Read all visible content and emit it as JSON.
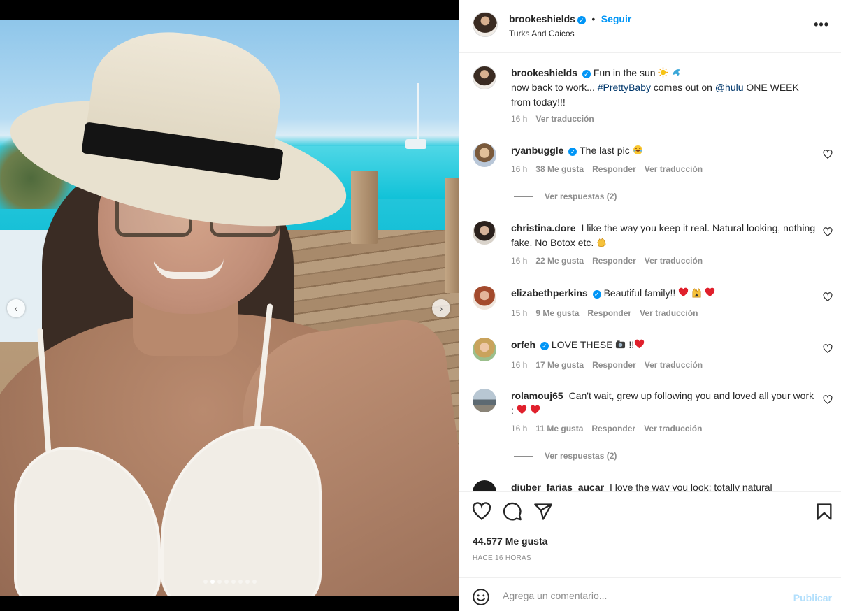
{
  "post": {
    "username": "brookeshields",
    "follow_label": "Seguir",
    "separator": "•",
    "location": "Turks And Caicos",
    "more_label": "•••",
    "carousel": {
      "slides": 8,
      "active": 1,
      "prev_label": "‹",
      "next_label": "›"
    }
  },
  "caption": {
    "username": "brookeshields",
    "text_line1": "Fun in the sun",
    "text_pre": "now back to work...",
    "hashtag": "#PrettyBaby",
    "text_mid": "comes out on",
    "mention": "@hulu",
    "text_post": "ONE WEEK from today!!!",
    "time": "16 h",
    "translate": "Ver traducción"
  },
  "comments": [
    {
      "username": "ryanbuggle",
      "verified": true,
      "text": "The last pic",
      "time": "16 h",
      "likes": "38 Me gusta",
      "reply": "Responder",
      "translate": "Ver traducción",
      "replies_label": "Ver respuestas (2)"
    },
    {
      "username": "christina.dore",
      "verified": false,
      "text": "I like the way you keep it real. Natural looking, nothing fake. No Botox etc.",
      "time": "16 h",
      "likes": "22 Me gusta",
      "reply": "Responder",
      "translate": "Ver traducción"
    },
    {
      "username": "elizabethperkins",
      "verified": true,
      "text": "Beautiful family!!",
      "time": "15 h",
      "likes": "9 Me gusta",
      "reply": "Responder",
      "translate": "Ver traducción"
    },
    {
      "username": "orfeh",
      "verified": true,
      "text": "LOVE THESE",
      "text_suffix": "!!",
      "time": "16 h",
      "likes": "17 Me gusta",
      "reply": "Responder",
      "translate": "Ver traducción"
    },
    {
      "username": "rolamouj65",
      "verified": false,
      "text": "Can't wait, grew up following you and loved all your work :",
      "time": "16 h",
      "likes": "11 Me gusta",
      "reply": "Responder",
      "translate": "Ver traducción",
      "replies_label": "Ver respuestas (2)"
    },
    {
      "username": "djuber_farias_aucar",
      "verified": false,
      "text": "I love the way you look; totally natural"
    }
  ],
  "actions": {
    "likes": "44.577 Me gusta",
    "time": "Hace 16 horas"
  },
  "composer": {
    "placeholder": "Agrega un comentario...",
    "publish": "Publicar"
  },
  "colors": {
    "accent": "#0095f6",
    "link": "#00376b",
    "muted": "#8e8e8e",
    "heart": "#ed1c24"
  }
}
